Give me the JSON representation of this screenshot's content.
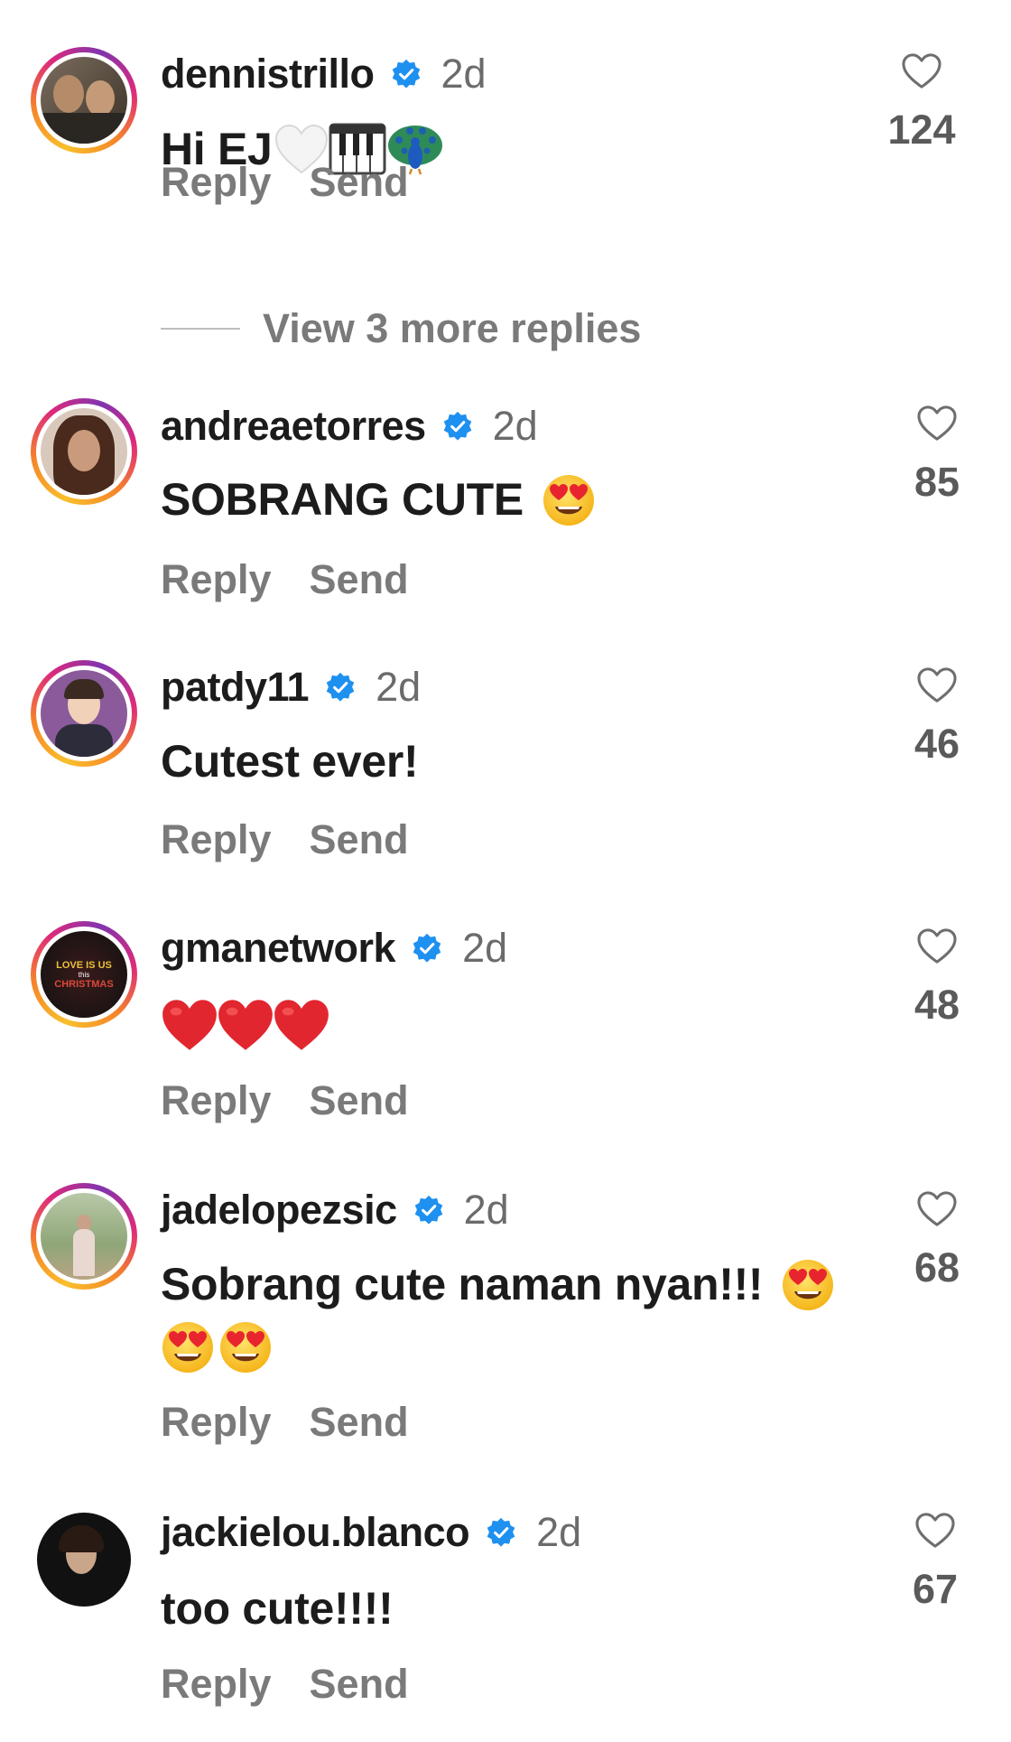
{
  "comments": [
    {
      "username": "dennistrillo",
      "time": "2d",
      "text": "Hi EJ",
      "likes": "124",
      "reply": "Reply",
      "send": "Send"
    },
    {
      "username": "andreaetorres",
      "time": "2d",
      "text": "SOBRANG CUTE",
      "likes": "85",
      "reply": "Reply",
      "send": "Send"
    },
    {
      "username": "patdy11",
      "time": "2d",
      "text": "Cutest ever!",
      "likes": "46",
      "reply": "Reply",
      "send": "Send"
    },
    {
      "username": "gmanetwork",
      "time": "2d",
      "text": "",
      "likes": "48",
      "reply": "Reply",
      "send": "Send",
      "avatar_text": {
        "line1": "LOVE IS US",
        "line2": "this",
        "line3": "CHRISTMAS"
      }
    },
    {
      "username": "jadelopezsic",
      "time": "2d",
      "text": "Sobrang cute naman nyan!!!",
      "likes": "68",
      "reply": "Reply",
      "send": "Send"
    },
    {
      "username": "jackielou.blanco",
      "time": "2d",
      "text": "too cute!!!!",
      "likes": "67",
      "reply": "Reply",
      "send": "Send"
    }
  ],
  "view_more_replies": "View 3 more replies",
  "colors": {
    "verified": "#1e90f0",
    "heart_red": "#e2262f",
    "accent_ring": "#dd2a7b"
  },
  "icons": [
    "verified-badge-icon",
    "heart-outline-icon",
    "white-heart-emoji",
    "piano-emoji",
    "peacock-emoji",
    "heart-eyes-emoji",
    "red-heart-emoji"
  ]
}
